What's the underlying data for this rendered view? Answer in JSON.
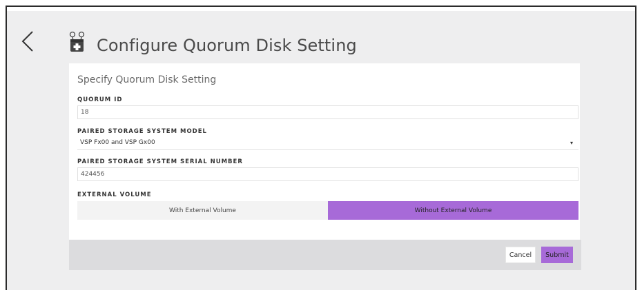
{
  "header": {
    "title": "Configure Quorum Disk Setting",
    "back_icon": "chevron-left-icon",
    "title_icon": "quorum-disk-icon"
  },
  "panel": {
    "title": "Specify Quorum Disk Setting",
    "fields": {
      "quorum_id": {
        "label": "QUORUM ID",
        "value": "18"
      },
      "model": {
        "label": "PAIRED STORAGE SYSTEM MODEL",
        "value": "VSP Fx00 and VSP Gx00",
        "caret": "▾"
      },
      "serial": {
        "label": "PAIRED STORAGE SYSTEM SERIAL NUMBER",
        "value": "424456"
      },
      "external_volume": {
        "label": "EXTERNAL VOLUME",
        "options": [
          "With External Volume",
          "Without External Volume"
        ],
        "selected": "Without External Volume"
      }
    }
  },
  "footer": {
    "cancel_label": "Cancel",
    "submit_label": "Submit"
  },
  "colors": {
    "accent": "#a76ad8",
    "background": "#eeeeef",
    "panel": "#ffffff",
    "footer": "#dcdcde"
  }
}
